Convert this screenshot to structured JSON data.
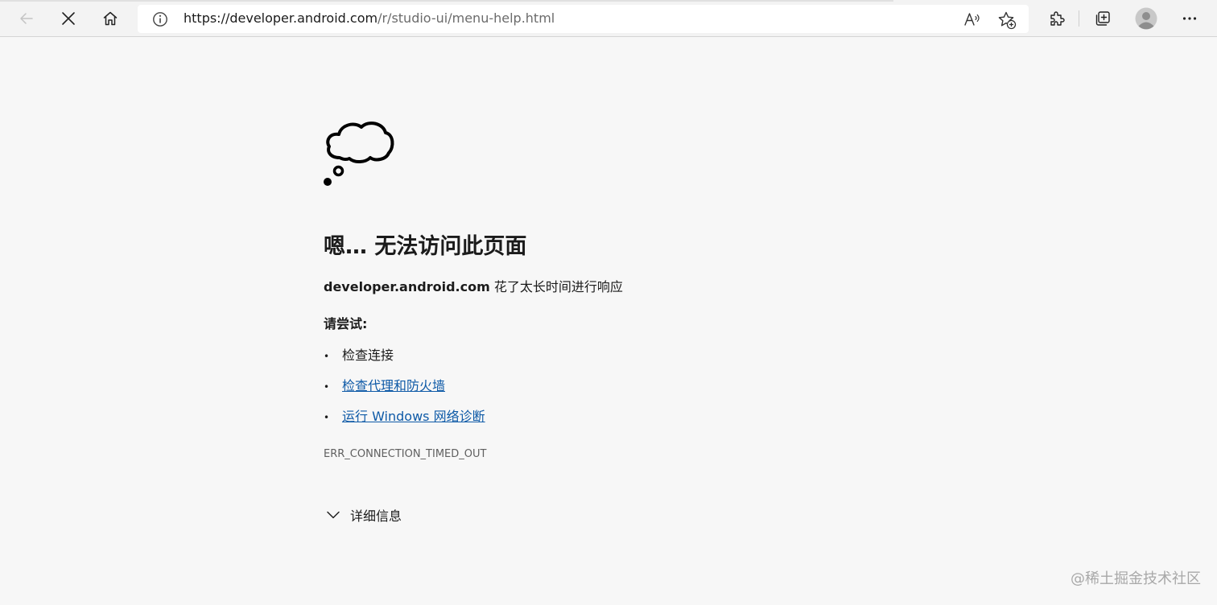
{
  "browser": {
    "url_host": "https://developer.android.com",
    "url_path": "/r/studio-ui/menu-help.html",
    "icons": {
      "back": "back-arrow-icon",
      "stop": "close-icon",
      "home": "home-icon",
      "info": "info-icon",
      "read_aloud": "read-aloud-icon",
      "favorite": "add-favorite-icon",
      "extensions": "extensions-icon",
      "collections": "collections-icon",
      "profile": "profile-avatar-icon",
      "more": "more-icon"
    }
  },
  "error_page": {
    "headline": "嗯… 无法访问此页面",
    "host": "developer.android.com",
    "message": " 花了太长时间进行响应",
    "try_label": "请尝试:",
    "suggestions": [
      {
        "text": "检查连接",
        "link": false
      },
      {
        "text": "检查代理和防火墙",
        "link": true
      },
      {
        "text": "运行 Windows 网络诊断",
        "link": true
      }
    ],
    "bullet": "•",
    "error_code": "ERR_CONNECTION_TIMED_OUT",
    "details_label": "详细信息"
  },
  "watermark": "@稀土掘金技术社区",
  "colors": {
    "link": "#0e5aa7",
    "background": "#f7f7f7",
    "toolbar": "#f3f3f3"
  }
}
